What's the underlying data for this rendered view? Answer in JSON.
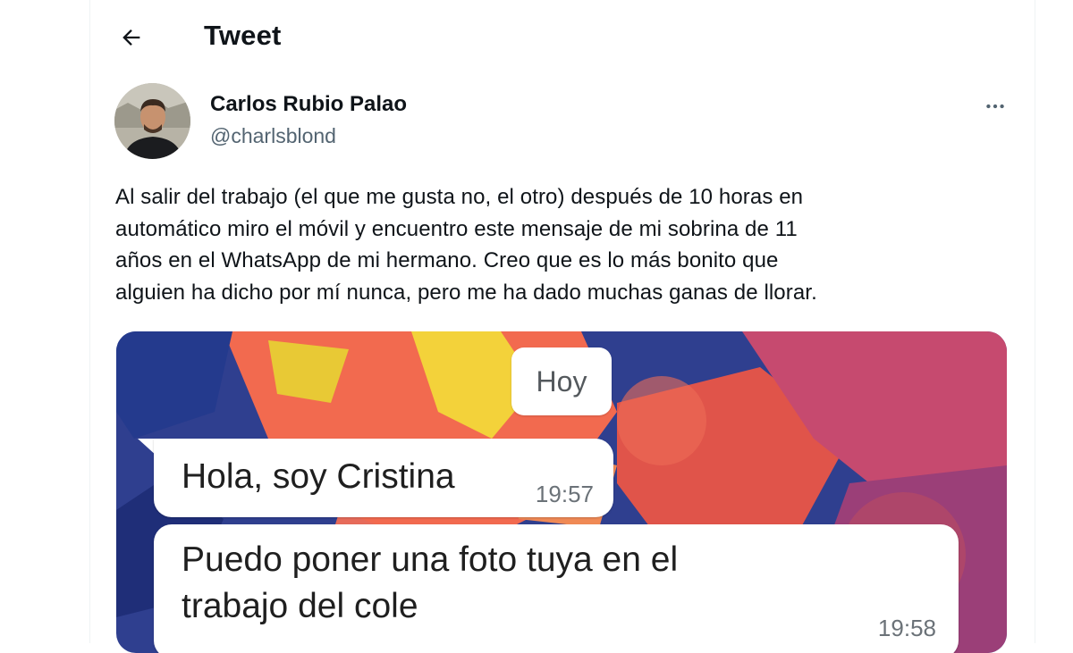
{
  "header": {
    "title": "Tweet"
  },
  "author": {
    "name": "Carlos Rubio Palao",
    "handle": "@charlsblond"
  },
  "tweet": {
    "text": "Al salir del trabajo (el que me gusta no, el otro) después de 10 horas en\nautomático miro el móvil y encuentro este mensaje de mi sobrina de 11\naños en el WhatsApp de mi hermano. Creo que es lo más bonito que\nalguien ha dicho por mí nunca, pero me ha dado muchas ganas de llorar."
  },
  "media": {
    "date_label": "Hoy",
    "messages": [
      {
        "text": "Hola, soy Cristina",
        "time": "19:57"
      },
      {
        "text": "Puedo poner una foto tuya en el\ntrabajo del cole",
        "time": "19:58"
      }
    ]
  },
  "icons": {
    "back": "arrow-left-icon",
    "more": "more-horizontal-icon"
  },
  "colors": {
    "text": "#0f1419",
    "secondary": "#536471",
    "border": "#eff3f4"
  }
}
